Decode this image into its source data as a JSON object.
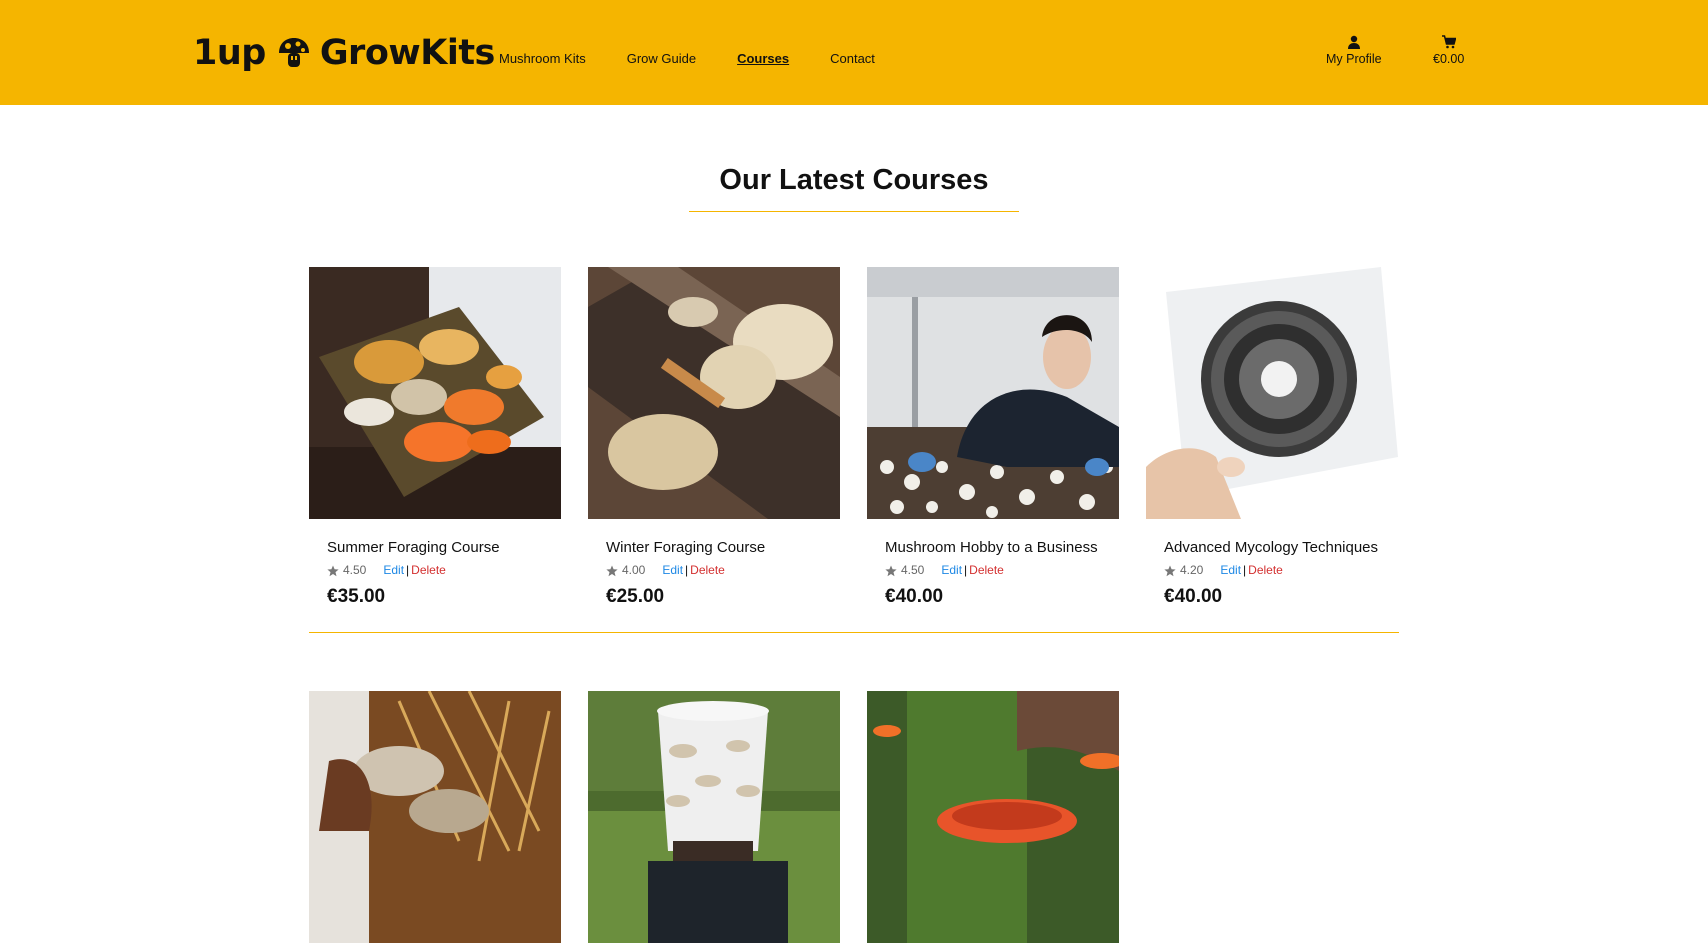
{
  "header": {
    "logo_left": "1up",
    "logo_right": "GrowKits",
    "nav": [
      {
        "label": "Mushroom Kits"
      },
      {
        "label": "Grow Guide"
      },
      {
        "label": "Courses",
        "active": true
      },
      {
        "label": "Contact"
      }
    ],
    "profile_label": "My Profile",
    "cart_total": "€0.00"
  },
  "main": {
    "title": "Our Latest Courses"
  },
  "courses": [
    {
      "name": "Summer Foraging Course",
      "rating": "4.50",
      "edit": "Edit",
      "separator": "|",
      "delete": "Delete",
      "price": "€35.00"
    },
    {
      "name": "Winter Foraging Course",
      "rating": "4.00",
      "edit": "Edit",
      "separator": "|",
      "delete": "Delete",
      "price": "€25.00"
    },
    {
      "name": "Mushroom Hobby to a Business",
      "rating": "4.50",
      "edit": "Edit",
      "separator": "|",
      "delete": "Delete",
      "price": "€40.00"
    },
    {
      "name": "Advanced Mycology Techniques",
      "rating": "4.20",
      "edit": "Edit",
      "separator": "|",
      "delete": "Delete",
      "price": "€40.00"
    }
  ],
  "colors": {
    "header_bg": "#F5B500",
    "accent_rule": "#F5B500",
    "edit_link": "#1e88e5",
    "delete_link": "#d32f2f"
  }
}
